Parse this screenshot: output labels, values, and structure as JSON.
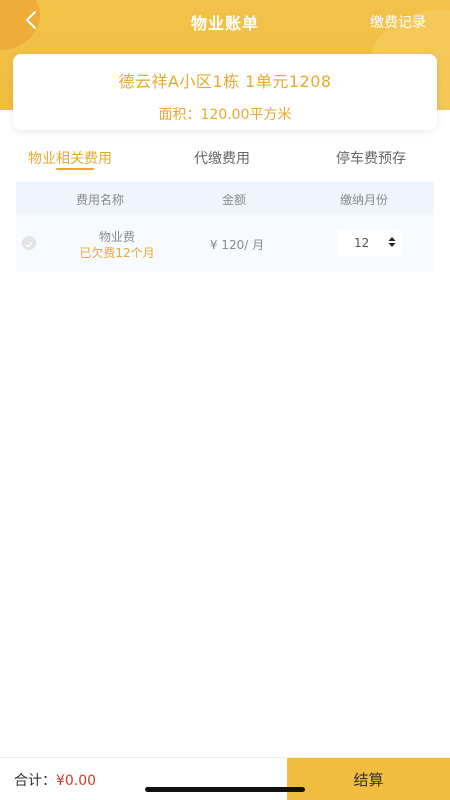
{
  "header": {
    "title": "物业账单",
    "history_label": "缴费记录",
    "brand_color": "#f0bd3f"
  },
  "address": {
    "name": "德云祥A小区1栋 1单元1208",
    "area": "面积：120.00平方米"
  },
  "tabs": [
    {
      "label": "物业相关费用",
      "active": true
    },
    {
      "label": "代缴费用",
      "active": false
    },
    {
      "label": "停车费预存",
      "active": false
    }
  ],
  "table": {
    "headers": [
      "费用名称",
      "金额",
      "缴纳月份"
    ],
    "rows": [
      {
        "name": "物业费",
        "arrears": "已欠费12个月",
        "amount": "¥ 120/ 月",
        "months": "12",
        "checked": false
      }
    ]
  },
  "footer": {
    "total_label": "合计：",
    "total_value": "¥0.00",
    "checkout_label": "结算"
  },
  "icons": {
    "back": "chevron-left-icon",
    "check": "check-circle-icon",
    "select": "sort-arrows-icon"
  }
}
